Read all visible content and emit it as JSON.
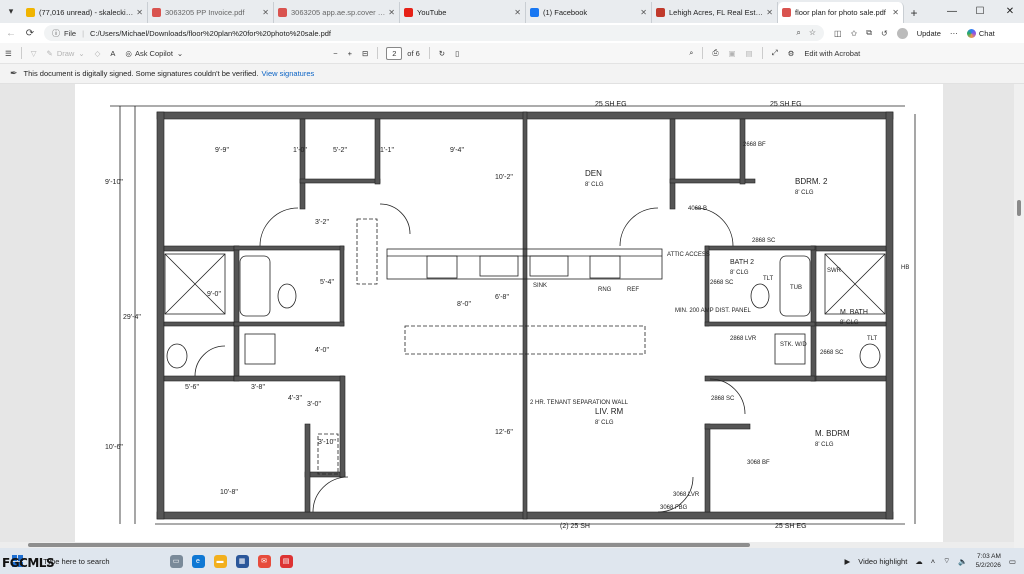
{
  "browser": {
    "tabs": [
      {
        "label": "(77,016 unread) - skaleckimike@...",
        "favicon": "mail-icon",
        "color": "#f0b400",
        "active": false,
        "dim": false
      },
      {
        "label": "3063205 PP Invoice.pdf",
        "favicon": "pdf-icon",
        "color": "#d9534f",
        "active": false,
        "dim": true
      },
      {
        "label": "3063205 app.ae.sp.cover letter.cc...",
        "favicon": "pdf-icon",
        "color": "#d9534f",
        "active": false,
        "dim": true
      },
      {
        "label": "YouTube",
        "favicon": "youtube-icon",
        "color": "#e62117",
        "active": false,
        "dim": false
      },
      {
        "label": "(1) Facebook",
        "favicon": "facebook-icon",
        "color": "#1877f2",
        "active": false,
        "dim": false
      },
      {
        "label": "Lehigh Acres, FL Real Estate - Hom...",
        "favicon": "home-icon",
        "color": "#c0392b",
        "active": false,
        "dim": false
      },
      {
        "label": "floor plan for photo sale.pdf",
        "favicon": "pdf-icon",
        "color": "#d9534f",
        "active": true,
        "dim": false
      }
    ],
    "address": {
      "file_label": "File",
      "url": "C:/Users/Michael/Downloads/floor%20plan%20for%20photo%20sale.pdf"
    },
    "update_label": "Update",
    "chat_label": "Chat"
  },
  "pdf_toolbar": {
    "draw_label": "Draw",
    "copilot_label": "Ask Copilot",
    "minus": "−",
    "plus": "+",
    "page_current": "2",
    "page_total": "of 6",
    "edit_acrobat": "Edit with Acrobat"
  },
  "signature_bar": {
    "message": "This document is digitally signed. Some signatures couldn't be verified.",
    "link": "View signatures"
  },
  "plan": {
    "top_left_dim": "25 SH EG",
    "top_right_dim": "25 SH EG",
    "bottom_left_dim": "(2) 25 SH",
    "bottom_right_dim": "25 SH EG",
    "dim_9_9": "9'-9\"",
    "dim_9_4": "9'-4\"",
    "dim_1_0a": "1'-0\"",
    "dim_5_2": "5'-2\"",
    "dim_1_1": "1'-1\"",
    "dim_9_10": "9'-10\"",
    "dim_29_4": "29'-4\"",
    "dim_9_0": "9'-0\"",
    "dim_10_6": "10'-6\"",
    "dim_10_2": "10'-2\"",
    "dim_3_2": "3'-2\"",
    "dim_5_4": "5'-4\"",
    "dim_6_8": "6'-8\"",
    "dim_8_0": "8'-0\"",
    "dim_4_0": "4'-0\"",
    "dim_5_6": "5'-6\"",
    "dim_3_8": "3'-8\"",
    "dim_4_3": "4'-3\"",
    "dim_3_0": "3'-0\"",
    "dim_3_10": "3'-10\"",
    "dim_12_6": "12'-6\"",
    "dim_10_8": "10'-8\"",
    "den": "DEN",
    "clg_den": "8' CLG",
    "bdrm2": "BDRM. 2",
    "clg_bdrm2": "8' CLG",
    "code_2668_bf": "2668 BF",
    "code_4068_b": "4068 B",
    "code_2868_sc": "2868 SC",
    "attic": "ATTIC ACCESS",
    "bath2": "BATH 2",
    "clg_bath2": "8' CLG",
    "code_2668_sc": "2668 SC",
    "tlt": "TLT",
    "tub": "TUB",
    "swr": "SWR",
    "mbath": "M. BATH",
    "clg_mbath": "8' CLG",
    "tlt2": "TLT",
    "code_2868_lvr": "2868 LVR",
    "stk_wd": "STK. W/D",
    "code_2668_sc2": "2668 SC",
    "sink": "SINK",
    "rng": "RNG",
    "ref": "REF",
    "panel": "MIN. 200 AMP DIST. PANEL",
    "separation": "2 HR. TENANT SEPARATION WALL",
    "livrm": "LIV. RM",
    "clg_livrm": "8' CLG",
    "code_2868_sc2": "2868 SC",
    "mbdrm": "M. BDRM",
    "clg_mbdrm": "8' CLG",
    "code_3068_bf": "3068 BF",
    "code_3068_lvr": "3068 LVR",
    "code_3068_fbg": "3068 FBG",
    "hb": "HB"
  },
  "taskbar": {
    "search_placeholder": "Type here to search",
    "video_highlight": "Video highlight",
    "time": "7:03 AM",
    "date": "5/2/2026"
  },
  "watermark": "FGCMLS"
}
